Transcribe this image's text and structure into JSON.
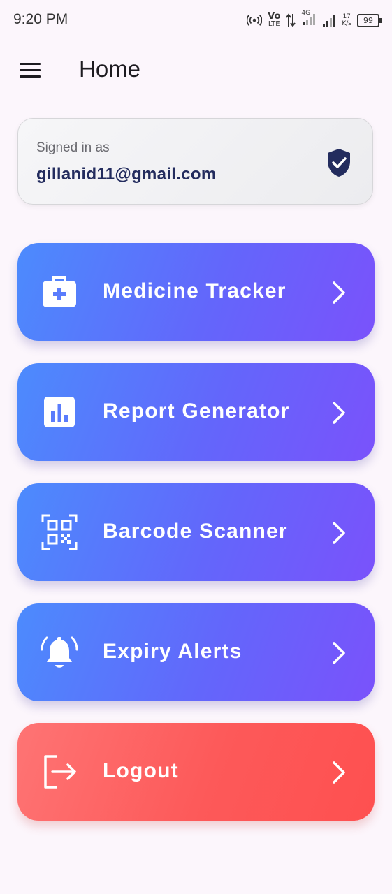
{
  "status_bar": {
    "time": "9:20 PM",
    "volte_top": "Vo",
    "volte_bottom": "LTE",
    "network": "4G",
    "speed_value": "17",
    "speed_unit": "K/s",
    "battery": "99"
  },
  "app_bar": {
    "title": "Home",
    "menu_icon": "hamburger-menu-icon"
  },
  "account": {
    "label": "Signed in as",
    "email": "gillanid11@gmail.com",
    "icon": "verified-shield-icon"
  },
  "menu": {
    "items": [
      {
        "label": "Medicine Tracker",
        "icon": "medical-bag-icon",
        "chevron_icon": "chevron-right-icon"
      },
      {
        "label": "Report Generator",
        "icon": "bar-chart-icon",
        "chevron_icon": "chevron-right-icon"
      },
      {
        "label": "Barcode Scanner",
        "icon": "qr-scan-icon",
        "chevron_icon": "chevron-right-icon"
      },
      {
        "label": "Expiry Alerts",
        "icon": "alarm-bell-icon",
        "chevron_icon": "chevron-right-icon"
      },
      {
        "label": "Logout",
        "icon": "logout-icon",
        "chevron_icon": "chevron-right-icon"
      }
    ]
  },
  "colors": {
    "background": "#fcf6fc",
    "card_gradient_start": "#4c8bfd",
    "card_gradient_end": "#7a52fb",
    "logout_gradient_start": "#fe7474",
    "logout_gradient_end": "#fe5050",
    "email_text": "#232c5e"
  }
}
